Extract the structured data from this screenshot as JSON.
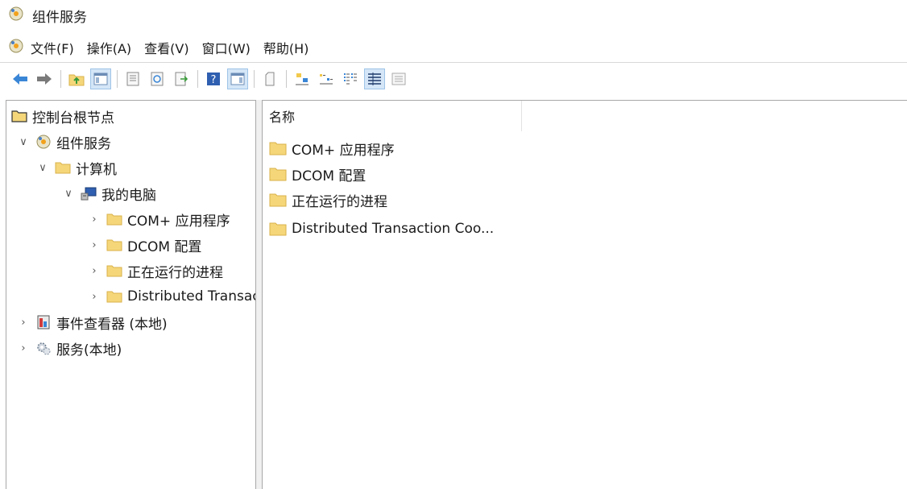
{
  "window": {
    "title": "组件服务"
  },
  "menu": [
    "文件(F)",
    "操作(A)",
    "查看(V)",
    "窗口(W)",
    "帮助(H)"
  ],
  "toolbar": {
    "buttons": [
      "back-icon",
      "forward-icon",
      "up-folder-icon",
      "show-hide-tree-icon",
      "properties-icon",
      "refresh-icon",
      "export-list-icon",
      "help-icon",
      "show-hide-action-pane-icon",
      "new-window-icon",
      "large-icons-icon",
      "small-icons-icon",
      "list-view-icon",
      "detail-view-icon",
      "status-view-icon"
    ],
    "active": [
      "show-hide-tree-icon",
      "show-hide-action-pane-icon",
      "detail-view-icon"
    ]
  },
  "tree": {
    "root": "控制台根节点",
    "component_services": "组件服务",
    "computers": "计算机",
    "my_computer": "我的电脑",
    "children": [
      "COM+ 应用程序",
      "DCOM 配置",
      "正在运行的进程",
      "Distributed Transaction Coordinator"
    ],
    "event_viewer": "事件查看器 (本地)",
    "services": "服务(本地)"
  },
  "list": {
    "column_name": "名称",
    "items": [
      "COM+ 应用程序",
      "DCOM 配置",
      "正在运行的进程",
      "Distributed Transaction Coo..."
    ]
  },
  "colors": {
    "folder": "#f5d77a",
    "folder_dark": "#d9b24a",
    "arrow": "#3a86d6",
    "selected": "#d4e6f7"
  }
}
